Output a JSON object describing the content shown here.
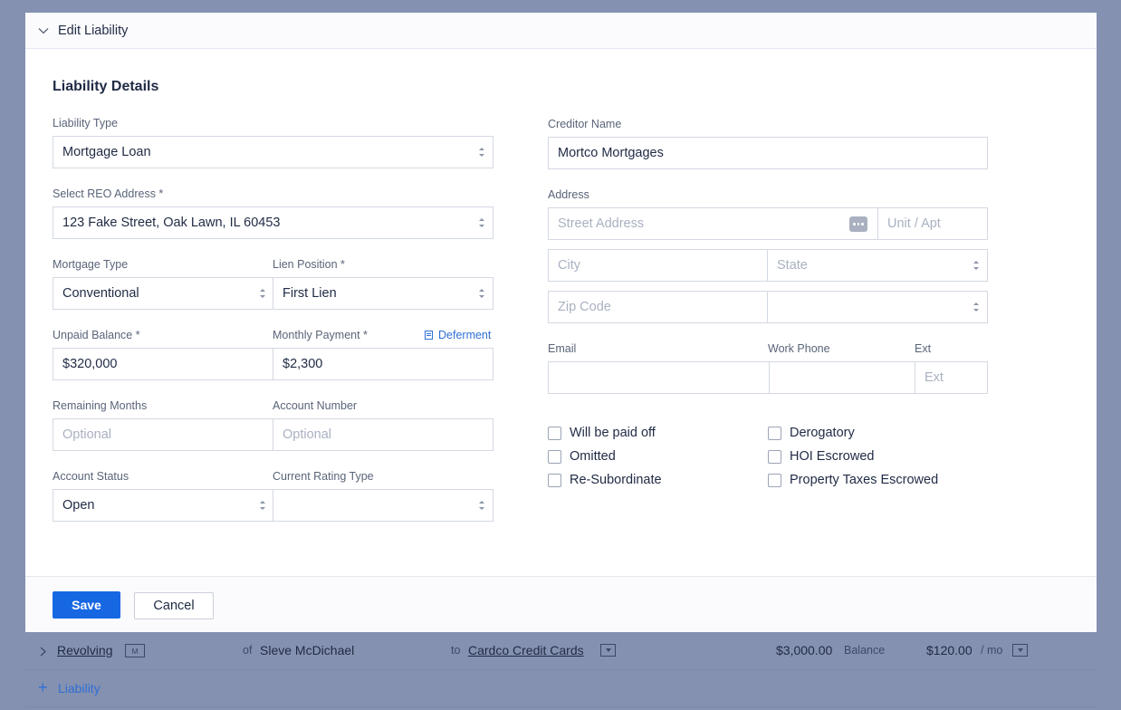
{
  "modal": {
    "header_title": "Edit Liability",
    "section_title": "Liability Details"
  },
  "left": {
    "liability_type": {
      "label": "Liability Type",
      "value": "Mortgage Loan"
    },
    "reo_address": {
      "label": "Select REO Address *",
      "value": "123 Fake Street, Oak Lawn, IL 60453"
    },
    "mortgage_type": {
      "label": "Mortgage Type",
      "value": "Conventional"
    },
    "lien_position": {
      "label": "Lien Position *",
      "value": "First Lien"
    },
    "unpaid_balance": {
      "label": "Unpaid Balance *",
      "value": "$320,000"
    },
    "monthly_payment": {
      "label": "Monthly Payment *",
      "value": "$2,300"
    },
    "deferment_link": "Deferment",
    "remaining_months": {
      "label": "Remaining Months",
      "placeholder": "Optional"
    },
    "account_number": {
      "label": "Account Number",
      "placeholder": "Optional"
    },
    "account_status": {
      "label": "Account Status",
      "value": "Open"
    },
    "current_rating_type": {
      "label": "Current Rating Type",
      "value": ""
    }
  },
  "right": {
    "creditor_name": {
      "label": "Creditor Name",
      "value": "Mortco Mortgages"
    },
    "address": {
      "label": "Address",
      "street_placeholder": "Street Address",
      "unit_placeholder": "Unit / Apt",
      "city_placeholder": "City",
      "state_placeholder": "State",
      "zip_placeholder": "Zip Code"
    },
    "email": {
      "label": "Email",
      "value": ""
    },
    "work_phone": {
      "label": "Work Phone",
      "value": ""
    },
    "ext": {
      "label": "Ext",
      "placeholder": "Ext"
    },
    "checkboxes": {
      "will_be_paid_off": "Will be paid off",
      "omitted": "Omitted",
      "re_subordinate": "Re-Subordinate",
      "derogatory": "Derogatory",
      "hoi_escrowed": "HOI Escrowed",
      "property_taxes_escrowed": "Property Taxes Escrowed"
    }
  },
  "footer": {
    "save": "Save",
    "cancel": "Cancel"
  },
  "background": {
    "row": {
      "type": "Revolving",
      "badge": "M",
      "of_text": "of",
      "borrower": "Sleve McDichael",
      "to_text": "to",
      "creditor": "Cardco Credit Cards",
      "balance": "$3,000.00",
      "balance_label": "Balance",
      "payment": "$120.00",
      "payment_unit": "/ mo"
    },
    "add_liability": "Liability",
    "add_icon": "plus-icon"
  }
}
